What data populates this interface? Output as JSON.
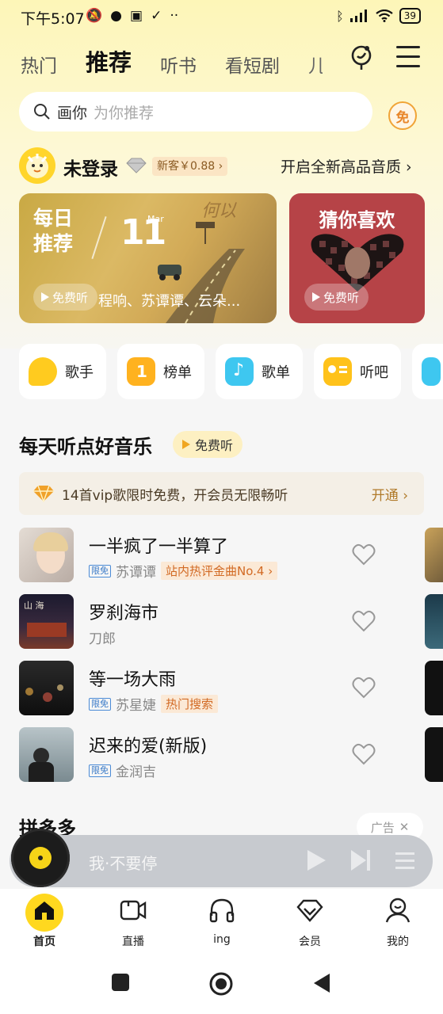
{
  "status_bar": {
    "time": "下午5:07",
    "battery": "39",
    "left_icons": [
      "mute-icon",
      "chat-icon",
      "app-icon",
      "check-icon",
      "more-dots-icon"
    ],
    "right_icons": [
      "bluetooth-icon",
      "signal-icon",
      "wifi-icon",
      "battery-icon"
    ]
  },
  "top_nav": {
    "tabs": [
      {
        "label": "热门",
        "active": false
      },
      {
        "label": "推荐",
        "active": true
      },
      {
        "label": "听书",
        "active": false
      },
      {
        "label": "看短剧",
        "active": false
      },
      {
        "label": "儿",
        "active": false
      }
    ]
  },
  "search": {
    "keyword": "画你",
    "hint": "为你推荐",
    "free_badge": "免"
  },
  "user": {
    "login_text": "未登录",
    "newbie_tag": "新客￥0.88",
    "quality_link": "开启全新高品音质"
  },
  "daily_card": {
    "title": "每日推荐",
    "day": "11",
    "month": "Mar",
    "watermark": "何以",
    "free_label": "免费听",
    "artists": "程响、苏谭谭、云朵..."
  },
  "guess_card": {
    "title": "猜你喜欢",
    "free_label": "免费听"
  },
  "shortcuts": [
    {
      "label": "歌手",
      "icon": "singer-icon",
      "color": "#ffcb1f"
    },
    {
      "label": "榜单",
      "icon": "chart-icon",
      "color": "#ffb21f"
    },
    {
      "label": "歌单",
      "icon": "playlist-icon",
      "color": "#3ec7f0"
    },
    {
      "label": "听吧",
      "icon": "radio-icon",
      "color": "#ffc21a"
    }
  ],
  "section": {
    "title": "每天听点好音乐",
    "free_label": "免费听"
  },
  "vip_banner": {
    "text": "14首vip歌限时免费，开会员无限畅听",
    "action": "开通"
  },
  "songs": [
    {
      "title": "一半疯了一半算了",
      "limited": "限免",
      "artist": "苏谭谭",
      "tag": "站内热评金曲No.4"
    },
    {
      "title": "罗刹海市",
      "limited": "",
      "artist": "刀郎",
      "tag": ""
    },
    {
      "title": "等一场大雨",
      "limited": "限免",
      "artist": "苏星婕",
      "tag": "热门搜索"
    },
    {
      "title": "迟来的爱(新版)",
      "limited": "限免",
      "artist": "金润吉",
      "tag": ""
    }
  ],
  "ad": {
    "title": "拼多多",
    "tag": "广告"
  },
  "now_playing": {
    "title": "我·不要停"
  },
  "bottom_nav": [
    {
      "label": "首页",
      "icon": "home-icon",
      "active": true
    },
    {
      "label": "直播",
      "icon": "live-video-icon",
      "active": false
    },
    {
      "label": "ing",
      "icon": "headphones-icon",
      "active": false
    },
    {
      "label": "会员",
      "icon": "vip-diamond-icon",
      "active": false
    },
    {
      "label": "我的",
      "icon": "profile-icon",
      "active": false
    }
  ],
  "colors": {
    "accent": "#ffd81f",
    "vip_text": "#b07a2a",
    "hot_tag": "#d26a24",
    "limited_tag": "#3b7bc8"
  }
}
